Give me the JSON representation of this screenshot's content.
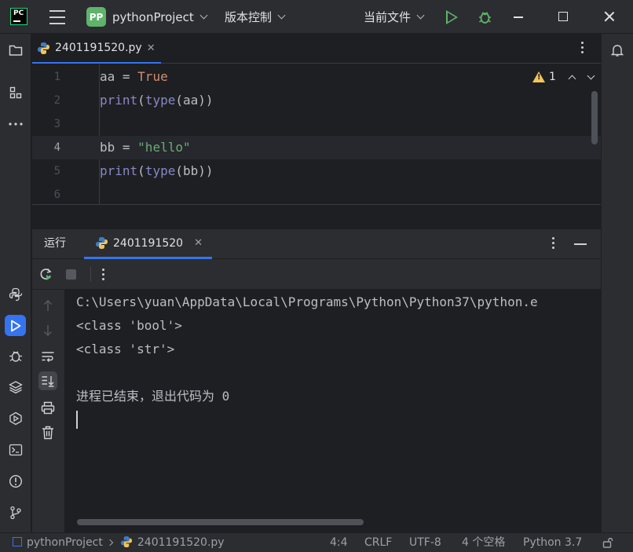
{
  "titlebar": {
    "logo_text": "PC",
    "project_badge": "PP",
    "project_name": "pythonProject",
    "vcs_label": "版本控制",
    "run_config": "当前文件"
  },
  "editor": {
    "tab_filename": "2401191520.py",
    "inspection_count": "1",
    "current_line": 4,
    "lines": [
      {
        "num": "1",
        "tokens": [
          {
            "t": "aa = ",
            "c": "plain"
          },
          {
            "t": "True",
            "c": "kw"
          }
        ]
      },
      {
        "num": "2",
        "tokens": [
          {
            "t": "print",
            "c": "fn"
          },
          {
            "t": "(",
            "c": "plain"
          },
          {
            "t": "type",
            "c": "fn"
          },
          {
            "t": "(aa))",
            "c": "plain"
          }
        ]
      },
      {
        "num": "3",
        "tokens": []
      },
      {
        "num": "4",
        "tokens": [
          {
            "t": "bb = ",
            "c": "plain"
          },
          {
            "t": "\"hello\"",
            "c": "str"
          }
        ]
      },
      {
        "num": "5",
        "tokens": [
          {
            "t": "print",
            "c": "fn"
          },
          {
            "t": "(",
            "c": "plain"
          },
          {
            "t": "type",
            "c": "fn"
          },
          {
            "t": "(bb))",
            "c": "plain"
          }
        ]
      },
      {
        "num": "6",
        "tokens": []
      }
    ]
  },
  "run_panel": {
    "title": "运行",
    "tab_label": "2401191520",
    "console_lines": [
      "C:\\Users\\yuan\\AppData\\Local\\Programs\\Python\\Python37\\python.e",
      "<class 'bool'>",
      "<class 'str'>",
      "",
      "进程已结束，退出代码为 0"
    ]
  },
  "statusbar": {
    "project": "pythonProject",
    "file": "2401191520.py",
    "position": "4:4",
    "line_ending": "CRLF",
    "encoding": "UTF-8",
    "indent": "4 个空格",
    "interpreter": "Python 3.7"
  },
  "colors": {
    "accent": "#3574f0",
    "run_green": "#5fb36b",
    "keyword": "#cf8e6d",
    "builtin": "#8888c6",
    "string": "#6aab73",
    "warning": "#f2c55c"
  }
}
